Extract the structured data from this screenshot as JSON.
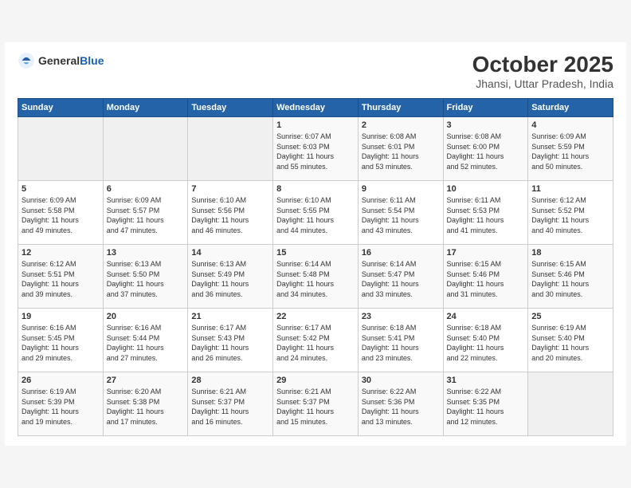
{
  "header": {
    "logo_general": "General",
    "logo_blue": "Blue",
    "month": "October 2025",
    "location": "Jhansi, Uttar Pradesh, India"
  },
  "weekdays": [
    "Sunday",
    "Monday",
    "Tuesday",
    "Wednesday",
    "Thursday",
    "Friday",
    "Saturday"
  ],
  "weeks": [
    [
      {
        "day": "",
        "info": ""
      },
      {
        "day": "",
        "info": ""
      },
      {
        "day": "",
        "info": ""
      },
      {
        "day": "1",
        "info": "Sunrise: 6:07 AM\nSunset: 6:03 PM\nDaylight: 11 hours\nand 55 minutes."
      },
      {
        "day": "2",
        "info": "Sunrise: 6:08 AM\nSunset: 6:01 PM\nDaylight: 11 hours\nand 53 minutes."
      },
      {
        "day": "3",
        "info": "Sunrise: 6:08 AM\nSunset: 6:00 PM\nDaylight: 11 hours\nand 52 minutes."
      },
      {
        "day": "4",
        "info": "Sunrise: 6:09 AM\nSunset: 5:59 PM\nDaylight: 11 hours\nand 50 minutes."
      }
    ],
    [
      {
        "day": "5",
        "info": "Sunrise: 6:09 AM\nSunset: 5:58 PM\nDaylight: 11 hours\nand 49 minutes."
      },
      {
        "day": "6",
        "info": "Sunrise: 6:09 AM\nSunset: 5:57 PM\nDaylight: 11 hours\nand 47 minutes."
      },
      {
        "day": "7",
        "info": "Sunrise: 6:10 AM\nSunset: 5:56 PM\nDaylight: 11 hours\nand 46 minutes."
      },
      {
        "day": "8",
        "info": "Sunrise: 6:10 AM\nSunset: 5:55 PM\nDaylight: 11 hours\nand 44 minutes."
      },
      {
        "day": "9",
        "info": "Sunrise: 6:11 AM\nSunset: 5:54 PM\nDaylight: 11 hours\nand 43 minutes."
      },
      {
        "day": "10",
        "info": "Sunrise: 6:11 AM\nSunset: 5:53 PM\nDaylight: 11 hours\nand 41 minutes."
      },
      {
        "day": "11",
        "info": "Sunrise: 6:12 AM\nSunset: 5:52 PM\nDaylight: 11 hours\nand 40 minutes."
      }
    ],
    [
      {
        "day": "12",
        "info": "Sunrise: 6:12 AM\nSunset: 5:51 PM\nDaylight: 11 hours\nand 39 minutes."
      },
      {
        "day": "13",
        "info": "Sunrise: 6:13 AM\nSunset: 5:50 PM\nDaylight: 11 hours\nand 37 minutes."
      },
      {
        "day": "14",
        "info": "Sunrise: 6:13 AM\nSunset: 5:49 PM\nDaylight: 11 hours\nand 36 minutes."
      },
      {
        "day": "15",
        "info": "Sunrise: 6:14 AM\nSunset: 5:48 PM\nDaylight: 11 hours\nand 34 minutes."
      },
      {
        "day": "16",
        "info": "Sunrise: 6:14 AM\nSunset: 5:47 PM\nDaylight: 11 hours\nand 33 minutes."
      },
      {
        "day": "17",
        "info": "Sunrise: 6:15 AM\nSunset: 5:46 PM\nDaylight: 11 hours\nand 31 minutes."
      },
      {
        "day": "18",
        "info": "Sunrise: 6:15 AM\nSunset: 5:46 PM\nDaylight: 11 hours\nand 30 minutes."
      }
    ],
    [
      {
        "day": "19",
        "info": "Sunrise: 6:16 AM\nSunset: 5:45 PM\nDaylight: 11 hours\nand 29 minutes."
      },
      {
        "day": "20",
        "info": "Sunrise: 6:16 AM\nSunset: 5:44 PM\nDaylight: 11 hours\nand 27 minutes."
      },
      {
        "day": "21",
        "info": "Sunrise: 6:17 AM\nSunset: 5:43 PM\nDaylight: 11 hours\nand 26 minutes."
      },
      {
        "day": "22",
        "info": "Sunrise: 6:17 AM\nSunset: 5:42 PM\nDaylight: 11 hours\nand 24 minutes."
      },
      {
        "day": "23",
        "info": "Sunrise: 6:18 AM\nSunset: 5:41 PM\nDaylight: 11 hours\nand 23 minutes."
      },
      {
        "day": "24",
        "info": "Sunrise: 6:18 AM\nSunset: 5:40 PM\nDaylight: 11 hours\nand 22 minutes."
      },
      {
        "day": "25",
        "info": "Sunrise: 6:19 AM\nSunset: 5:40 PM\nDaylight: 11 hours\nand 20 minutes."
      }
    ],
    [
      {
        "day": "26",
        "info": "Sunrise: 6:19 AM\nSunset: 5:39 PM\nDaylight: 11 hours\nand 19 minutes."
      },
      {
        "day": "27",
        "info": "Sunrise: 6:20 AM\nSunset: 5:38 PM\nDaylight: 11 hours\nand 17 minutes."
      },
      {
        "day": "28",
        "info": "Sunrise: 6:21 AM\nSunset: 5:37 PM\nDaylight: 11 hours\nand 16 minutes."
      },
      {
        "day": "29",
        "info": "Sunrise: 6:21 AM\nSunset: 5:37 PM\nDaylight: 11 hours\nand 15 minutes."
      },
      {
        "day": "30",
        "info": "Sunrise: 6:22 AM\nSunset: 5:36 PM\nDaylight: 11 hours\nand 13 minutes."
      },
      {
        "day": "31",
        "info": "Sunrise: 6:22 AM\nSunset: 5:35 PM\nDaylight: 11 hours\nand 12 minutes."
      },
      {
        "day": "",
        "info": ""
      }
    ]
  ]
}
